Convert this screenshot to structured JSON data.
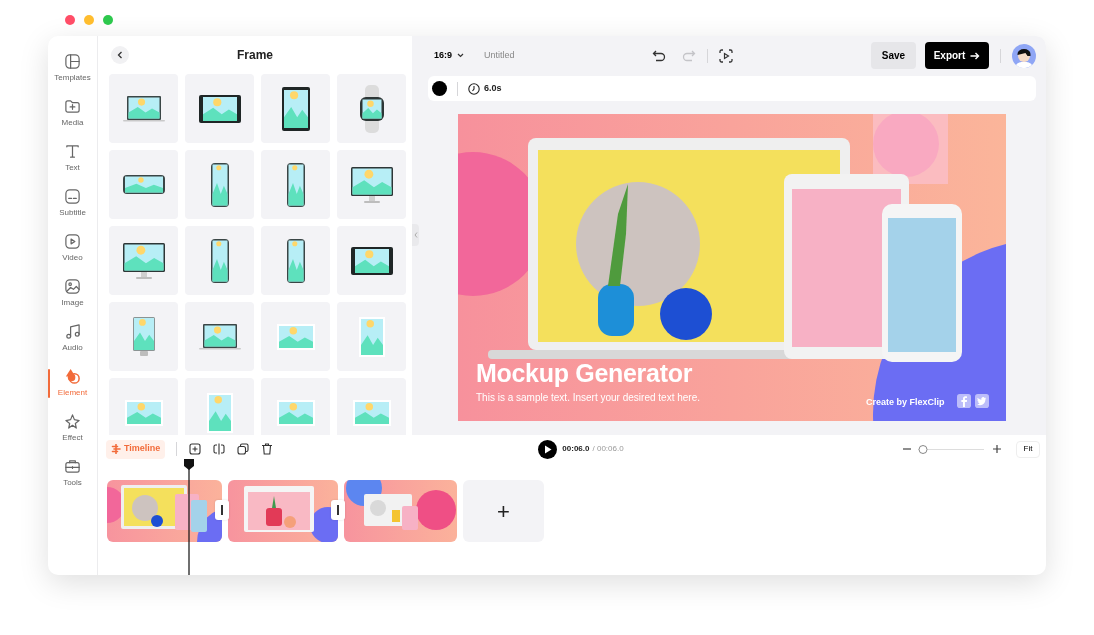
{
  "sidebar": {
    "items": [
      {
        "label": "Templates",
        "selected": false
      },
      {
        "label": "Media",
        "selected": false
      },
      {
        "label": "Text",
        "selected": false
      },
      {
        "label": "Subtitle",
        "selected": false
      },
      {
        "label": "Video",
        "selected": false
      },
      {
        "label": "Image",
        "selected": false
      },
      {
        "label": "Audio",
        "selected": false
      },
      {
        "label": "Element",
        "selected": true
      },
      {
        "label": "Effect",
        "selected": false
      },
      {
        "label": "Tools",
        "selected": false
      }
    ]
  },
  "panel": {
    "title": "Frame",
    "frames": [
      {
        "kind": "laptop"
      },
      {
        "kind": "tablet-landscape"
      },
      {
        "kind": "tablet"
      },
      {
        "kind": "watch"
      },
      {
        "kind": "phone-landscape"
      },
      {
        "kind": "phone"
      },
      {
        "kind": "phone"
      },
      {
        "kind": "monitor"
      },
      {
        "kind": "monitor"
      },
      {
        "kind": "phone"
      },
      {
        "kind": "phone"
      },
      {
        "kind": "tablet-landscape"
      },
      {
        "kind": "monitor-portrait"
      },
      {
        "kind": "laptop"
      },
      {
        "kind": "frame-landscape"
      },
      {
        "kind": "frame-portrait"
      },
      {
        "kind": "frame-landscape"
      },
      {
        "kind": "frame-portrait"
      },
      {
        "kind": "frame-landscape"
      },
      {
        "kind": "frame-landscape"
      }
    ]
  },
  "topbar": {
    "aspect": "16:9",
    "title": "Untitled",
    "undo": {
      "disabled": false
    },
    "redo": {
      "disabled": true
    },
    "save": "Save",
    "export": "Export"
  },
  "toolbar": {
    "duration": "6.0s"
  },
  "canvas": {
    "title": "Mockup Generator",
    "subtitle": "This is a sample text. Insert your desired text here.",
    "credit": "Create by FlexClip"
  },
  "timeline": {
    "label": "Timeline",
    "selected": true,
    "current": "00:06.0",
    "total": "/ 00:06.0",
    "zoom": {
      "level": 0.08
    },
    "fit": "Fit",
    "add_clip": "+"
  }
}
